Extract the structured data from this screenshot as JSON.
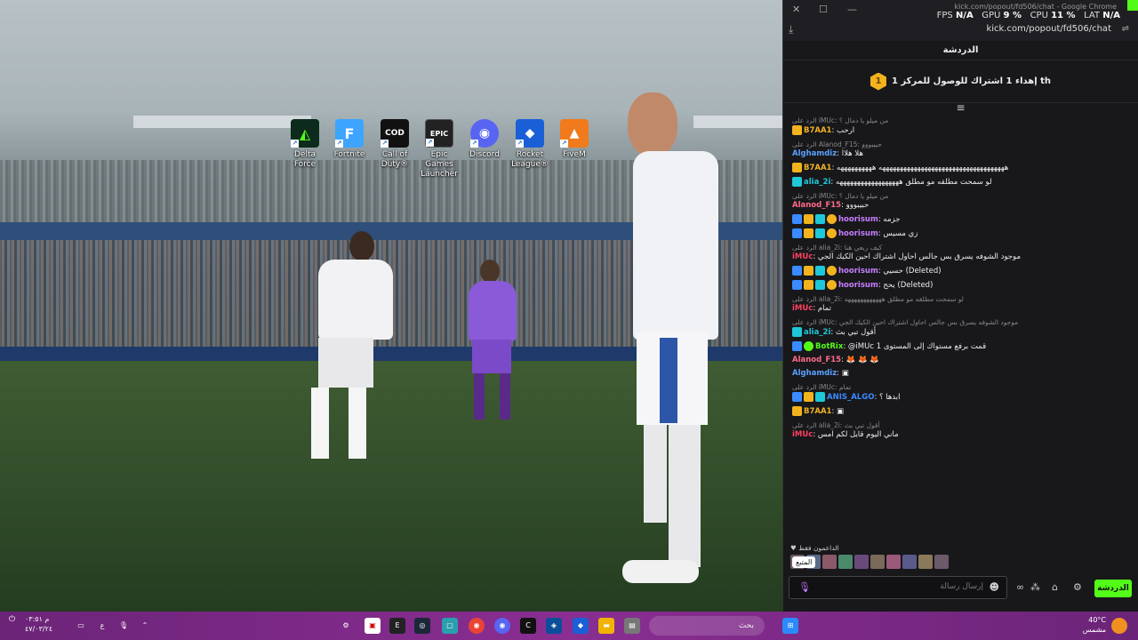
{
  "desktop": {
    "icons": [
      {
        "label": "Delta Force",
        "color": "#0c2b1c",
        "glyph": "◭"
      },
      {
        "label": "Fortnite",
        "color": "#3da4ff",
        "glyph": "F"
      },
      {
        "label": "Call of Duty®",
        "color": "#111111",
        "glyph": "COD"
      },
      {
        "label": "Epic Games Launcher",
        "color": "#222222",
        "glyph": "EPIC"
      },
      {
        "label": "Discord",
        "color": "#5865f2",
        "glyph": "◉"
      },
      {
        "label": "Rocket League®",
        "color": "#1b5fd6",
        "glyph": "◆"
      },
      {
        "label": "FiveM",
        "color": "#f07a1c",
        "glyph": "▲"
      }
    ]
  },
  "browser": {
    "window_title": "kick.com/popout/fd506/chat - Google Chrome",
    "url": "kick.com/popout/fd506/chat",
    "perf": {
      "fps_label": "FPS",
      "fps": "N/A",
      "gpu_label": "GPU",
      "gpu": "9 %",
      "cpu_label": "CPU",
      "cpu": "11 %",
      "lat_label": "LAT",
      "lat": "N/A"
    }
  },
  "chat": {
    "header": "الدردشة",
    "pinned_text": "إهداء 1 اشتراك للوصول للمركز 1 th",
    "pinned_rank": "1",
    "messages": [
      {
        "reply": "الرد على iMUc: من ميلو يا دمال ؟",
        "user": "B7AA1",
        "color": "#f3b31d",
        "badges": [
          "crown"
        ],
        "text": "ارحب"
      },
      {
        "reply": "الرد على Alanod_F15: حبيبووو",
        "user": "Alghamdiz",
        "color": "#5ba0ff",
        "badges": [],
        "text": "هلا هلاا"
      },
      {
        "reply": "",
        "user": "B7AA1",
        "color": "#f3b31d",
        "badges": [
          "crown"
        ],
        "text": "ههههههههههههههههههههههههههههههههههههه ههههههههههه"
      },
      {
        "reply": "",
        "user": "alia_2i",
        "color": "#1ec8d8",
        "badges": [
          "cyan"
        ],
        "text": "لو سمحت مطلقه مو مطلق ههههههههههههههههههه"
      },
      {
        "reply": "الرد على iMUc: من ميلو يا دمال ؟",
        "user": "Alanod_F15",
        "color": "#ff6a8a",
        "badges": [],
        "text": "حبيبووو"
      },
      {
        "reply": "",
        "user": "hoorisum",
        "color": "#c77dff",
        "badges": [
          "blue",
          "crown",
          "cyan",
          "coin"
        ],
        "text": "جزمه"
      },
      {
        "reply": "",
        "user": "hoorisum",
        "color": "#c77dff",
        "badges": [
          "blue",
          "crown",
          "cyan",
          "coin"
        ],
        "text": "زي مسيس"
      },
      {
        "reply": "الرد على alia_2i: كيف ربعي هنا",
        "user": "iMUc",
        "color": "#ff4060",
        "badges": [],
        "text": "موجود الشوفه يسرق بس جالس احاول اشتراك احين الكيك الجي"
      },
      {
        "reply": "",
        "user": "hoorisum",
        "color": "#c77dff",
        "badges": [
          "blue",
          "crown",
          "cyan",
          "coin"
        ],
        "text": "حسيي (Deleted)"
      },
      {
        "reply": "",
        "user": "hoorisum",
        "color": "#c77dff",
        "badges": [
          "blue",
          "crown",
          "cyan",
          "coin"
        ],
        "text": "يحح (Deleted)"
      },
      {
        "reply": "الرد على alia_2i: لو سمحت مطلقه مو مطلق ههههههههههههه",
        "user": "iMUc",
        "color": "#ff4060",
        "badges": [],
        "text": "تمام"
      },
      {
        "reply": "الرد على iMUc: موجود الشوفه يسرق بس جالس احاول اشتراك احين الكيك الجي",
        "user": "alia_2i",
        "color": "#1ec8d8",
        "badges": [
          "cyan"
        ],
        "text": "أقول تبي بث"
      },
      {
        "reply": "",
        "user": "BotRix",
        "color": "#53fc18",
        "badges": [
          "blue",
          "green"
        ],
        "text": "@iMUc قمت برفع مستواك إلى المستوى 1"
      },
      {
        "reply": "",
        "user": "Alanod_F15",
        "color": "#ff6a8a",
        "badges": [],
        "text": "🦊 🦊 🦊"
      },
      {
        "reply": "",
        "user": "Alghamdiz",
        "color": "#5ba0ff",
        "badges": [],
        "text": "▣"
      },
      {
        "reply": "الرد على iMUc: تمام",
        "user": "ANIS_ALGO",
        "color": "#3a8bff",
        "badges": [
          "blue",
          "crown",
          "cyan"
        ],
        "text": "ابدها ؟"
      },
      {
        "reply": "",
        "user": "B7AA1",
        "color": "#f3b31d",
        "badges": [
          "crown"
        ],
        "text": "▣"
      },
      {
        "reply": "الرد على alia_2i: أقول تبي بث",
        "user": "iMUc",
        "color": "#ff4060",
        "badges": [],
        "text": "ماني اليوم قايل لكم امس"
      }
    ],
    "supporters_label": "الداعمون فقط",
    "tooltip": "المتبع",
    "input_placeholder": "إرسال رسالة",
    "send_label": "الدردشة"
  },
  "taskbar": {
    "search_placeholder": "بحث",
    "clock_time": "م ٠٣:٥١",
    "clock_date": "٤٧/٠٣/٢٤",
    "lang": "ع",
    "weather_temp": "40°C",
    "weather_desc": "مشمس"
  }
}
